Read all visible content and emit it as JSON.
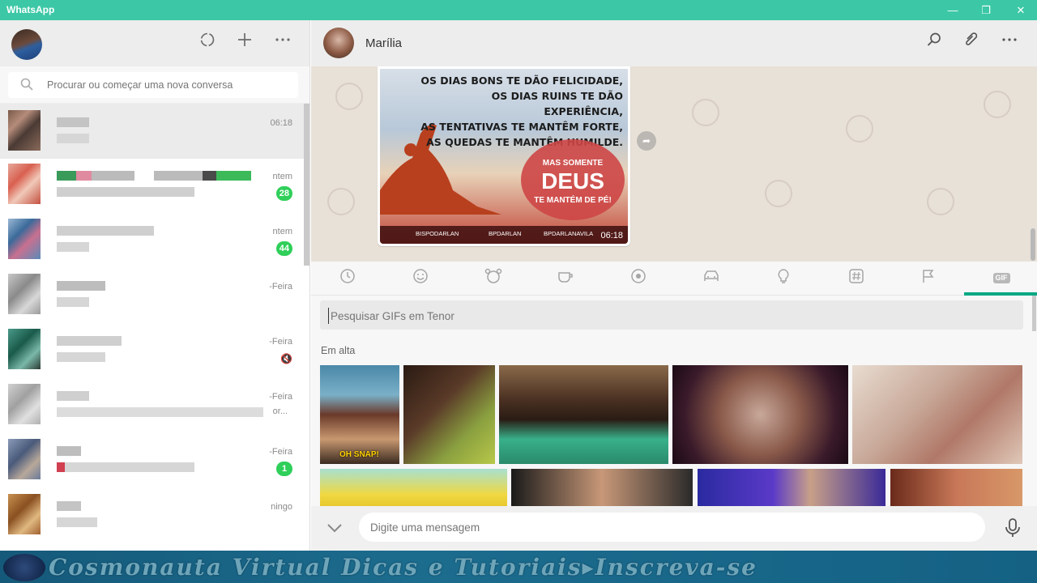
{
  "window": {
    "title": "WhatsApp",
    "controls": [
      "—",
      "❐",
      "✕"
    ]
  },
  "left_header": {
    "icons": [
      "status-icon",
      "new-chat-icon",
      "menu-icon"
    ]
  },
  "search": {
    "placeholder": "Procurar ou começar uma nova conversa"
  },
  "chats": [
    {
      "time": "06:18",
      "badge": ""
    },
    {
      "time": "ntem",
      "badge": "28"
    },
    {
      "time": "ntem",
      "badge": "44"
    },
    {
      "time": "-Feira",
      "badge": ""
    },
    {
      "time": "-Feira",
      "badge": "",
      "muted": true
    },
    {
      "time": "-Feira",
      "badge": ""
    },
    {
      "time": "-Feira",
      "badge": "1"
    },
    {
      "time": "ningo",
      "badge": ""
    }
  ],
  "chat_item_preview_fragment": "or...",
  "conversation": {
    "contact_name": "Marília",
    "image_message": {
      "quote_lines": [
        "OS DIAS BONS TE DÃO FELICIDADE,",
        "OS DIAS RUINS TE DÃO EXPERIÊNCIA,",
        "AS TENTATIVAS TE MANTÊM FORTE,",
        "AS QUEDAS TE MANTÊM HUMILDE."
      ],
      "circle_top": "MAS SOMENTE",
      "circle_main": "DEUS",
      "circle_bottom": "TE MANTÉM DE PÉ!",
      "socials": [
        "BISPODARLAN",
        "BPDARLAN",
        "BPDARLANAVILA"
      ],
      "time": "06:18"
    }
  },
  "emoji_tabs": {
    "gif_label": "GIF",
    "icons": [
      "recent-icon",
      "smiley-icon",
      "animal-icon",
      "food-icon",
      "sports-icon",
      "car-icon",
      "bulb-icon",
      "symbols-icon",
      "flag-icon",
      "gif-icon"
    ]
  },
  "gif_panel": {
    "search_placeholder": "Pesquisar GIFs em Tenor",
    "section_title": "Em alta",
    "gif_caption": "OH SNAP!"
  },
  "composer": {
    "placeholder": "Digite uma mensagem"
  },
  "banner": {
    "text": "Cosmonauta Virtual Dicas e Tutoriais▸Inscreva-se"
  },
  "colors": {
    "accent": "#00a884",
    "titlebar": "#3cc8a6",
    "badge": "#2fcf5a"
  }
}
